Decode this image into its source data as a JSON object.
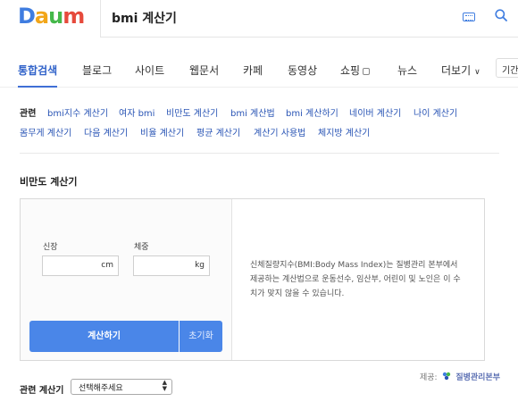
{
  "logo": {
    "letters": [
      "D",
      "a",
      "u",
      "m"
    ],
    "colors": [
      "#3f7de0",
      "#f2a619",
      "#45b84a",
      "#e64a3c"
    ]
  },
  "search": {
    "query": "bmi 계산기"
  },
  "tabs": [
    {
      "label": "통합검색",
      "active": true
    },
    {
      "label": "블로그"
    },
    {
      "label": "사이트"
    },
    {
      "label": "웹문서"
    },
    {
      "label": "카페"
    },
    {
      "label": "동영상"
    },
    {
      "label": "쇼핑"
    },
    {
      "label": "뉴스"
    },
    {
      "label": "더보기"
    }
  ],
  "period_button": "기간",
  "related": {
    "title": "관련",
    "links": [
      "bmi지수 계산기",
      "여자 bmi",
      "비만도 계산기",
      "bmi 계산법",
      "bmi 계산하기",
      "네이버 계산기",
      "나이 계산기",
      "몸무게 계산기",
      "다음 계산기",
      "비율 계산기",
      "평균 계산기",
      "계산기 사용법",
      "체지방 계산기"
    ]
  },
  "calculator": {
    "title": "비만도 계산기",
    "height_label": "신장",
    "height_unit": "cm",
    "weight_label": "체중",
    "weight_unit": "kg",
    "calc_button": "계산하기",
    "reset_button": "초기화",
    "description": "신체질량지수(BMI:Body Mass Index)는 질병관리 본부에서 제공하는 계산법으로 운동선수, 임산부, 어린이 및 노인은 이 수치가 맞지 않을 수 있습니다."
  },
  "provider": {
    "label": "제공:",
    "name": "질병관리본부"
  },
  "related_calc": {
    "label": "관련 계산기",
    "selected": "선택해주세요"
  },
  "colors": {
    "accent": "#4a86e8",
    "link": "#2a55b5",
    "active_tab": "#3062c9"
  }
}
